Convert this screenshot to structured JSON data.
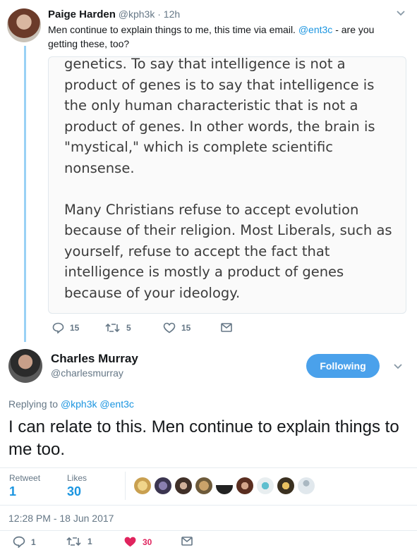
{
  "original": {
    "author_name": "Paige Harden",
    "author_handle": "@kph3k",
    "time": "· 12h",
    "text_before": "Men continue to explain things to me, this time via email.",
    "mention": "@ent3c",
    "text_after": "- are you getting these, too?",
    "image_text": "genetics. To say that intelligence is not a product of genes is to say that intelligence is the only human characteristic that is not a product of genes. In other words, the brain is \"mystical,\" which is complete scientific nonsense.\n\nMany Christians refuse to accept evolution because of their religion. Most Liberals, such as yourself, refuse to accept the fact that intelligence is mostly a product of genes because of your ideology.",
    "replies": "15",
    "retweets": "5",
    "likes": "15"
  },
  "reply": {
    "author_name": "Charles Murray",
    "author_handle": "@charlesmurray",
    "follow_label": "Following",
    "replying_prefix": "Replying to",
    "replying_to_1": "@kph3k",
    "replying_to_2": "@ent3c",
    "text": "I can relate to this. Men continue to explain things to me too.",
    "retweet_label": "Retweet",
    "retweet_count": "1",
    "likes_label": "Likes",
    "likes_count": "30",
    "timestamp": "12:28 PM - 18 Jun 2017",
    "action_replies": "1",
    "action_retweets": "1",
    "action_likes": "30"
  },
  "colors": {
    "accent": "#1b95e0",
    "follow_button": "#4aa1eb",
    "like_active": "#e0245e",
    "thread_line": "#9ad1f5"
  },
  "icons": [
    "chevron-down-icon",
    "reply-icon",
    "retweet-icon",
    "heart-icon",
    "mail-icon"
  ]
}
